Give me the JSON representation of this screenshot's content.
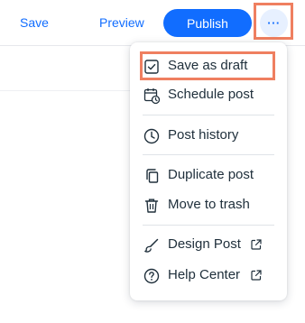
{
  "toolbar": {
    "save_label": "Save",
    "preview_label": "Preview",
    "publish_label": "Publish",
    "more_label": "···"
  },
  "menu": {
    "items": [
      {
        "label": "Save as draft",
        "icon": "draft-check-icon"
      },
      {
        "label": "Schedule post",
        "icon": "calendar-clock-icon"
      },
      {
        "label": "Post history",
        "icon": "history-clock-icon"
      },
      {
        "label": "Duplicate post",
        "icon": "duplicate-icon"
      },
      {
        "label": "Move to trash",
        "icon": "trash-icon"
      },
      {
        "label": "Design Post",
        "icon": "brush-icon"
      },
      {
        "label": "Help Center",
        "icon": "help-icon"
      }
    ]
  },
  "colors": {
    "accent": "#116dff",
    "highlight": "#ef7f60",
    "text": "#20303c"
  }
}
